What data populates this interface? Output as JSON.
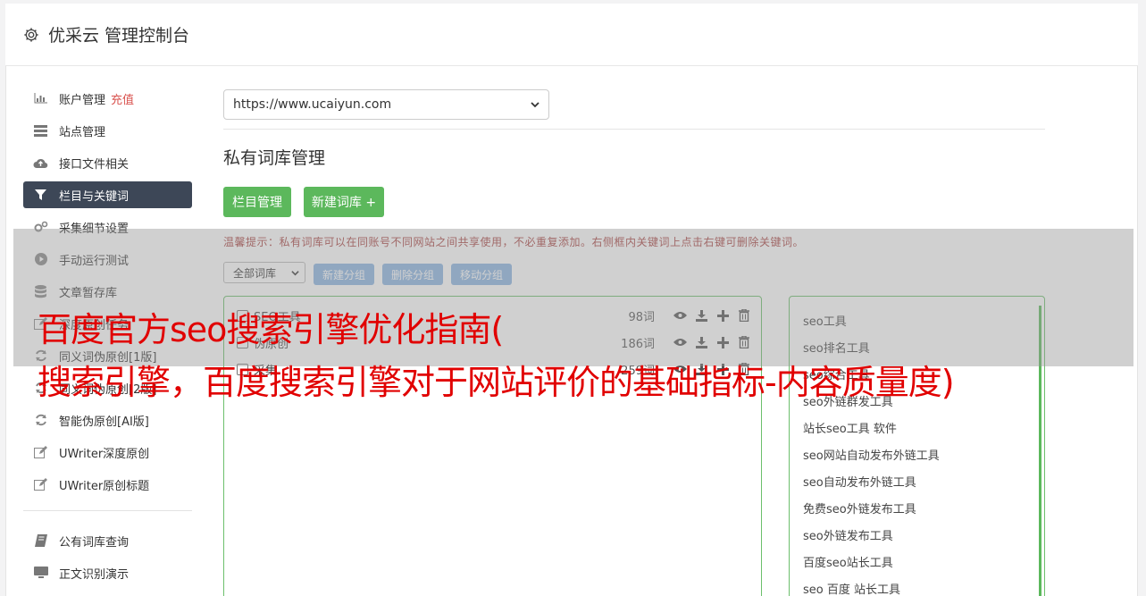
{
  "header": {
    "title": "优采云 管理控制台"
  },
  "sidebar": {
    "items": [
      {
        "label": "账户管理",
        "extra": "充值",
        "icon": "bar-chart-icon"
      },
      {
        "label": "站点管理",
        "icon": "server-icon"
      },
      {
        "label": "接口文件相关",
        "icon": "cloud-upload-icon"
      },
      {
        "label": "栏目与关键词",
        "icon": "filter-icon",
        "active": true
      },
      {
        "label": "采集细节设置",
        "icon": "gears-icon"
      },
      {
        "label": "手动运行测试",
        "icon": "play-circle-icon"
      },
      {
        "label": "文章暂存库",
        "icon": "database-icon"
      },
      {
        "label": "深度原创任务",
        "icon": "edit-icon"
      },
      {
        "label": "同义词伪原创[1版]",
        "icon": "refresh-icon"
      },
      {
        "label": "同义词伪原创[2版]",
        "icon": "refresh-icon"
      },
      {
        "label": "智能伪原创[AI版]",
        "icon": "refresh-icon"
      },
      {
        "label": "UWriter深度原创",
        "icon": "edit-icon"
      },
      {
        "label": "UWriter原创标题",
        "icon": "edit-icon"
      }
    ],
    "items2": [
      {
        "label": "公有词库查询",
        "icon": "book-icon"
      },
      {
        "label": "正文识别演示",
        "icon": "desktop-icon"
      }
    ]
  },
  "main": {
    "site_select": "https://www.ucaiyun.com",
    "section_title": "私有词库管理",
    "btn_column": "栏目管理",
    "btn_new": "新建词库 +",
    "tip": "温馨提示：私有词库可以在同账号不同网站之间共享使用，不必重复添加。右侧框内关键词上点击右键可删除关键词。",
    "filter_select": "全部词库",
    "btn_new_group": "新建分组",
    "btn_del_group": "删除分组",
    "btn_move_group": "移动分组",
    "libraries": [
      {
        "name": "SEO工具",
        "count": "98词"
      },
      {
        "name": "伪原创",
        "count": "186词"
      },
      {
        "name": "采集",
        "count": "259词"
      }
    ],
    "keywords": [
      "seo工具",
      "seo排名工具",
      "seo综合工具",
      "seo外链群发工具",
      "站长seo工具 软件",
      "seo网站自动发布外链工具",
      "seo自动发布外链工具",
      "免费seo外链发布工具",
      "seo外链发布工具",
      "百度seo站长工具",
      "seo 百度 站长工具"
    ]
  },
  "overlay": {
    "line1": "百度官方seo搜索引擎优化指南(",
    "line2": "搜索引擎，百度搜索引擎对于网站评价的基础指标-内容质量度)"
  }
}
